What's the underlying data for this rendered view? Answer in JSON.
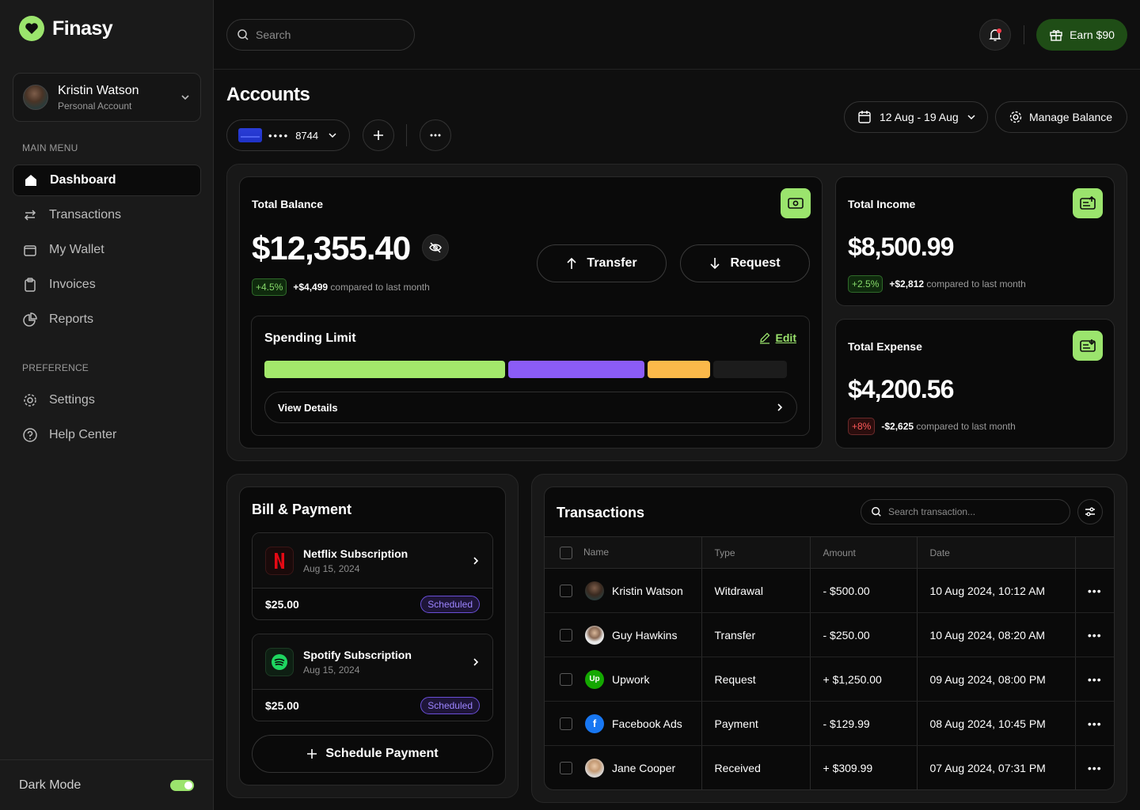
{
  "app": {
    "name": "Finasy"
  },
  "account": {
    "name": "Kristin Watson",
    "type": "Personal Account"
  },
  "sidebar": {
    "main_menu_label": "MAIN MENU",
    "items": [
      {
        "label": "Dashboard",
        "icon": "home-icon",
        "active": true
      },
      {
        "label": "Transactions",
        "icon": "arrows-icon"
      },
      {
        "label": "My Wallet",
        "icon": "wallet-icon"
      },
      {
        "label": "Invoices",
        "icon": "clipboard-icon"
      },
      {
        "label": "Reports",
        "icon": "pie-chart-icon"
      }
    ],
    "preference_label": "PREFERENCE",
    "pref_items": [
      {
        "label": "Settings",
        "icon": "gear-icon"
      },
      {
        "label": "Help Center",
        "icon": "help-icon"
      }
    ],
    "dark_mode_label": "Dark Mode",
    "dark_mode_on": true
  },
  "topbar": {
    "search_placeholder": "Search",
    "earn_label": "Earn $90"
  },
  "page": {
    "title": "Accounts",
    "card_mask": "••••",
    "card_last4": "8744",
    "date_range": "12 Aug - 19 Aug",
    "manage_label": "Manage Balance"
  },
  "balance": {
    "label": "Total Balance",
    "amount": "$12,355.40",
    "change_pct": "+4.5%",
    "change_amt": "+$4,499",
    "compare": "compared to last month",
    "transfer_label": "Transfer",
    "request_label": "Request"
  },
  "spending": {
    "title": "Spending Limit",
    "edit_label": "Edit",
    "view_details": "View Details",
    "segments": [
      {
        "share": 0.46,
        "color": "#a3e86b"
      },
      {
        "share": 0.26,
        "color": "#8b5cf6"
      },
      {
        "share": 0.12,
        "color": "#fbb94a"
      },
      {
        "share": 0.14,
        "color": "#1c1c1c"
      }
    ]
  },
  "income": {
    "label": "Total Income",
    "amount": "$8,500.99",
    "change_pct": "+2.5%",
    "change_amt": "+$2,812",
    "compare": "compared to last month"
  },
  "expense": {
    "label": "Total Expense",
    "amount": "$4,200.56",
    "change_pct": "+8%",
    "change_amt": "-$2,625",
    "compare": "compared to last month"
  },
  "bills": {
    "title": "Bill & Payment",
    "items": [
      {
        "name": "Netflix Subscription",
        "date": "Aug 15, 2024",
        "amount": "$25.00",
        "status": "Scheduled",
        "icon": "netflix-icon"
      },
      {
        "name": "Spotify Subscription",
        "date": "Aug 15, 2024",
        "amount": "$25.00",
        "status": "Scheduled",
        "icon": "spotify-icon"
      }
    ],
    "schedule_label": "Schedule Payment"
  },
  "transactions": {
    "title": "Transactions",
    "search_placeholder": "Search transaction...",
    "columns": [
      "Name",
      "Type",
      "Amount",
      "Date"
    ],
    "rows": [
      {
        "name": "Kristin Watson",
        "type": "Witdrawal",
        "amount": "- $500.00",
        "date": "10 Aug 2024, 10:12 AM",
        "avatar": "person-photo"
      },
      {
        "name": "Guy Hawkins",
        "type": "Transfer",
        "amount": "- $250.00",
        "date": "10 Aug 2024, 08:20 AM",
        "avatar": "person-photo"
      },
      {
        "name": "Upwork",
        "type": "Request",
        "amount": "+ $1,250.00",
        "date": "09 Aug 2024, 08:00 PM",
        "avatar": "upwork-logo",
        "avatar_text": "Up"
      },
      {
        "name": "Facebook Ads",
        "type": "Payment",
        "amount": "- $129.99",
        "date": "08 Aug 2024, 10:45 PM",
        "avatar": "facebook-logo",
        "avatar_text": "f"
      },
      {
        "name": "Jane Cooper",
        "type": "Received",
        "amount": "+ $309.99",
        "date": "07 Aug 2024, 07:31 PM",
        "avatar": "person-photo"
      }
    ]
  },
  "colors": {
    "accent": "#9be46d",
    "earn_bg": "#1f4d16",
    "scheduled": "#9c84ff",
    "negative": "#ff5a5a"
  }
}
